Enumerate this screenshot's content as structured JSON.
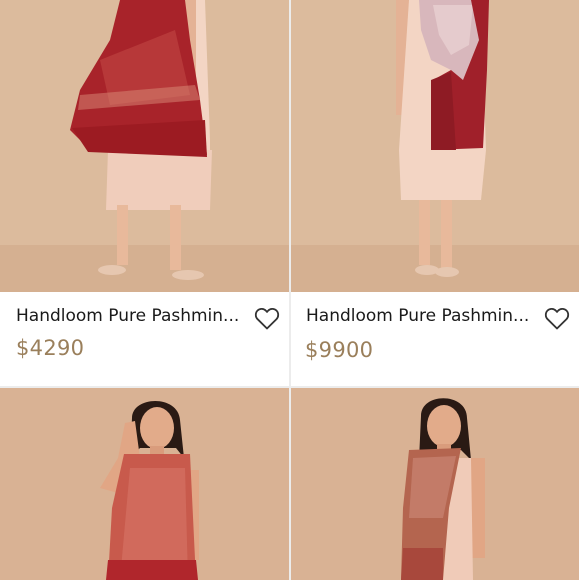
{
  "products": [
    {
      "title": "Handloom Pure Pashmin...",
      "price": "$4290",
      "icon": "heart-outline-icon"
    },
    {
      "title": "Handloom Pure Pashmin...",
      "price": "$9900",
      "icon": "heart-outline-icon"
    },
    {
      "title": "",
      "price": "",
      "icon": ""
    },
    {
      "title": "",
      "price": "",
      "icon": ""
    }
  ],
  "colors": {
    "price": "#9a7f5b",
    "background_studio": "#dfbd9f",
    "shawl_red": "#a41f24"
  }
}
